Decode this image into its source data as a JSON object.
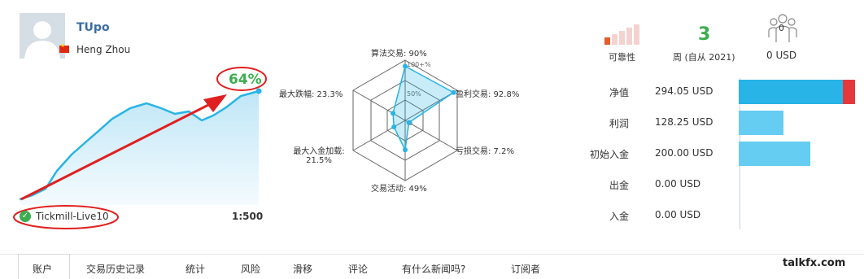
{
  "profile": {
    "username": "TUpo",
    "location": "Heng Zhou",
    "growth": "64%",
    "account": "Tickmill-Live10",
    "leverage": "1:500"
  },
  "radar": {
    "center_label": "0",
    "ring_labels": [
      "100+%",
      "50%"
    ],
    "labels": {
      "algo": "算法交易: 90%",
      "profit": "盈利交易: 92.8%",
      "loss": "亏损交易: 7.2%",
      "activity": "交易活动: 49%",
      "max_deposit_line1": "最大入金加载:",
      "max_deposit_line2": "21.5%",
      "max_drawdown": "最大跌幅: 23.3%"
    },
    "values_percent": {
      "algo": 90,
      "profit": 92.8,
      "loss": 7.2,
      "activity": 49,
      "max_deposit": 21.5,
      "max_drawdown": 23.3
    }
  },
  "stats": {
    "reliability_label": "可靠性",
    "reliability_level": 1,
    "weeks_value": "3",
    "weeks_label": "周 (自从 2021)",
    "subscribers_count": "0",
    "subscribers_funds": "0 USD"
  },
  "metrics": [
    {
      "label": "净值",
      "value": "294.05 USD",
      "fill": 0.88,
      "loss_fill": 0.1
    },
    {
      "label": "利润",
      "value": "128.25 USD",
      "fill": 0.38
    },
    {
      "label": "初始入金",
      "value": "200.00 USD",
      "fill": 0.6
    },
    {
      "label": "出金",
      "value": "0.00 USD",
      "fill": 0
    },
    {
      "label": "入金",
      "value": "0.00 USD",
      "fill": 0
    }
  ],
  "tabs": [
    "账户",
    "交易历史记录",
    "统计",
    "风险",
    "滑移",
    "评论",
    "有什么新闻吗?",
    "订阅者"
  ],
  "watermark": "talkfx.com",
  "colors": {
    "accent": "#28b4e6",
    "bar": "#66cdf2",
    "loss": "#e5383b",
    "green": "#3cae4f",
    "annotation": "#e02020"
  }
}
